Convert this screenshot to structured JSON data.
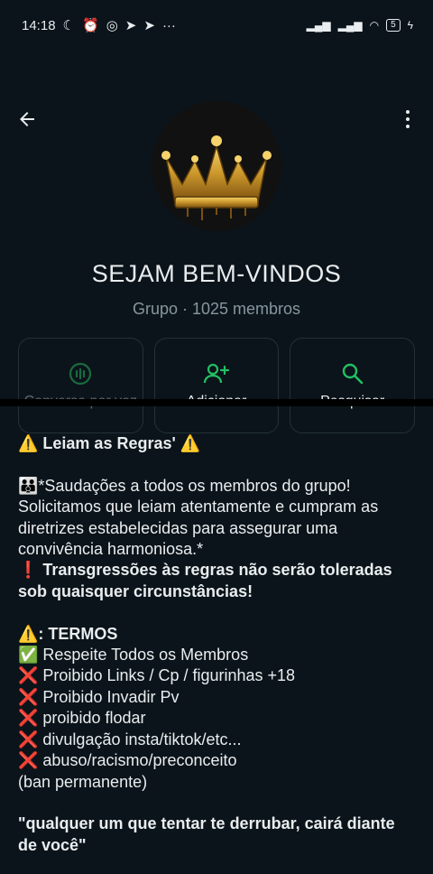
{
  "status_bar": {
    "time": "14:18",
    "battery": "5"
  },
  "group": {
    "name": "SEJAM BEM-VINDOS",
    "type": "Grupo",
    "separator": " · ",
    "members": "1025 membros"
  },
  "actions": [
    {
      "label": "Conversa por voz",
      "icon": "voice-chat-icon",
      "enabled": false
    },
    {
      "label": "Adicionar",
      "icon": "add-person-icon",
      "enabled": true
    },
    {
      "label": "Pesquisar",
      "icon": "search-icon",
      "enabled": true
    }
  ],
  "description": {
    "line1": "⚠️ Leiam as Regras' ⚠️",
    "para": "👪*Saudações a todos os membros do grupo! Solicitamos que leiam atentamente e cumpram as diretrizes estabelecidas para assegurar uma convivência harmoniosa.*",
    "warn": "❗ Transgressões às regras não serão toleradas sob quaisquer circunstâncias!",
    "terms_title": "⚠️: TERMOS",
    "terms": [
      "✅ Respeite Todos os Membros",
      "❌ Proibido Links / Cp / figurinhas +18",
      "❌ Proibido Invadir Pv",
      "❌ proibido flodar",
      "❌ divulgação insta/tiktok/etc...",
      "❌ abuso/racismo/preconceito"
    ],
    "ban": "(ban permanente)",
    "quote": "\"qualquer um que tentar te derrubar, cairá diante de você\""
  },
  "colors": {
    "accent": "#21c063",
    "background": "#0b141a",
    "muted": "#8696a0"
  }
}
